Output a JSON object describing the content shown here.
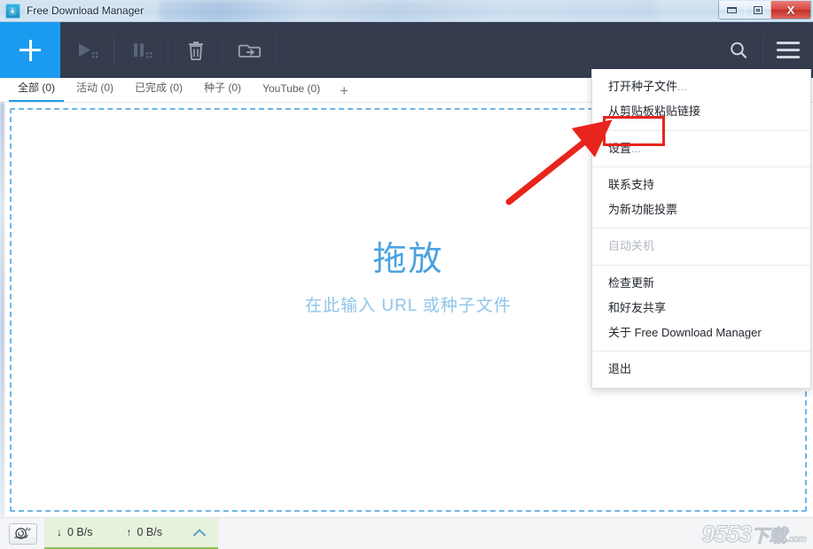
{
  "window": {
    "title": "Free Download Manager",
    "app_icon": "download-arrow-icon",
    "controls": {
      "minimize": "minimize-button",
      "maximize": "maximize-button",
      "close_label": "X"
    }
  },
  "toolbar": {
    "add_label": "+",
    "buttons": [
      {
        "name": "start-all-button",
        "icon": "play-all-icon",
        "state": "disabled"
      },
      {
        "name": "pause-all-button",
        "icon": "pause-all-icon",
        "state": "disabled"
      },
      {
        "name": "delete-button",
        "icon": "trash-icon",
        "state": "enabled"
      },
      {
        "name": "move-to-folder-button",
        "icon": "folder-arrow-icon",
        "state": "enabled"
      }
    ],
    "search": "search-icon",
    "menu": "hamburger-menu-icon"
  },
  "tabs": {
    "items": [
      {
        "label": "全部 (0)",
        "active": true
      },
      {
        "label": "活动 (0)",
        "active": false
      },
      {
        "label": "已完成 (0)",
        "active": false
      },
      {
        "label": "种子 (0)",
        "active": false
      },
      {
        "label": "YouTube (0)",
        "active": false
      }
    ],
    "add_label": "+"
  },
  "dropzone": {
    "title": "拖放",
    "subtitle": "在此输入 URL 或种子文件"
  },
  "menu": {
    "groups": [
      {
        "items": [
          {
            "label": "打开种子文件",
            "dots": "...",
            "disabled": false,
            "highlighted": false
          },
          {
            "label": "从剪贴板粘贴链接",
            "dots": "",
            "disabled": false,
            "highlighted": false
          }
        ]
      },
      {
        "items": [
          {
            "label": "设置",
            "dots": "...",
            "disabled": false,
            "highlighted": true
          }
        ]
      },
      {
        "items": [
          {
            "label": "联系支持",
            "dots": "",
            "disabled": false,
            "highlighted": false
          },
          {
            "label": "为新功能投票",
            "dots": "",
            "disabled": false,
            "highlighted": false
          }
        ]
      },
      {
        "items": [
          {
            "label": "自动关机",
            "dots": "",
            "disabled": true,
            "highlighted": false
          }
        ]
      },
      {
        "items": [
          {
            "label": "检查更新",
            "dots": "",
            "disabled": false,
            "highlighted": false
          },
          {
            "label": "和好友共享",
            "dots": "",
            "disabled": false,
            "highlighted": false
          },
          {
            "label": "关于 Free Download Manager",
            "dots": "",
            "disabled": false,
            "highlighted": false
          }
        ]
      },
      {
        "items": [
          {
            "label": "退出",
            "dots": "",
            "disabled": false,
            "highlighted": false
          }
        ]
      }
    ]
  },
  "statusbar": {
    "speed_limiter_icon": "snail-icon",
    "download_arrow": "↓",
    "download_speed": "0 B/s",
    "upload_arrow": "↑",
    "upload_speed": "0 B/s",
    "expand_icon": "chevron-up-icon"
  },
  "watermark": {
    "digits": "9553",
    "cn": "下载",
    "com": ".com"
  },
  "colors": {
    "toolbar_bg": "#343c4e",
    "accent_blue": "#1b9bf0",
    "dropzone_border": "#6fb6e8",
    "dropzone_title": "#4aa3e0",
    "dropzone_sub": "#8fc5ea",
    "status_green_bg": "#e7f2dc",
    "status_green_line": "#8cc152",
    "highlight_red": "#e8251c"
  }
}
